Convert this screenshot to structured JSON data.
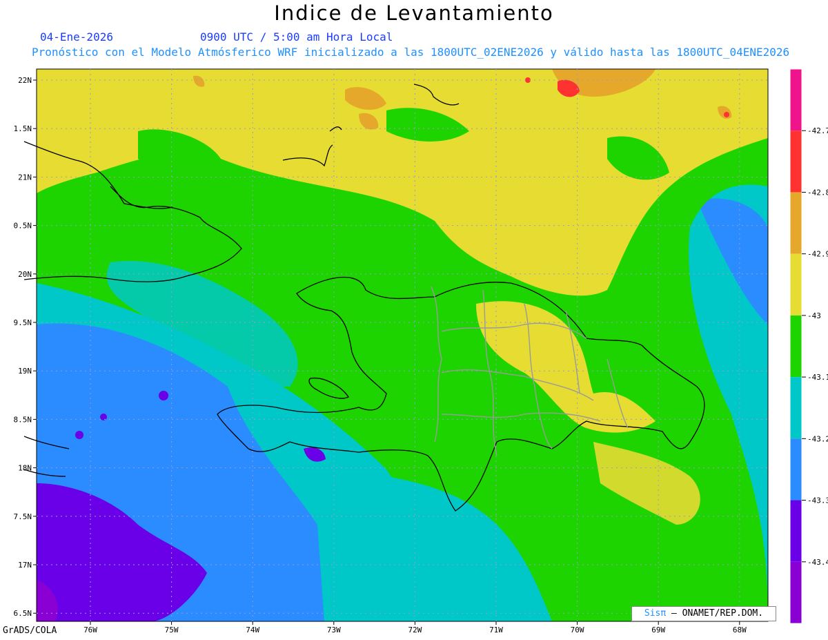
{
  "header": {
    "title": "Indice de Levantamiento",
    "date": "04-Ene-2026",
    "time": "0900 UTC / 5:00 am Hora Local",
    "subtitle": "Pronóstico con el Modelo Atmósferico WRF inicializado a las 1800UTC_02ENE2026 y válido hasta las  1800UTC_04ENE2026"
  },
  "map": {
    "lat_labels": [
      "22N",
      "1.5N",
      "21N",
      "0.5N",
      "20N",
      "9.5N",
      "19N",
      "8.5N",
      "18N",
      "7.5N",
      "17N",
      "6.5N"
    ],
    "lon_labels": [
      "76W",
      "75W",
      "74W",
      "73W",
      "72W",
      "71W",
      "70W",
      "69W",
      "68W"
    ],
    "field_colors": {
      "violet": "#8a00d4",
      "purple": "#6a00e8",
      "blue": "#2a8cff",
      "cyan": "#00c8c8",
      "green": "#1ed400",
      "yellow": "#e6dc32",
      "orange": "#e6a82a",
      "red": "#ff3232",
      "magenta": "#f0148c"
    }
  },
  "colorbar": {
    "labels": [
      "-42.7",
      "-42.8",
      "-42.9",
      "-43",
      "-43.1",
      "-43.2",
      "-43.3",
      "-43.4"
    ],
    "colors": [
      "#f0148c",
      "#ff3232",
      "#e6a82a",
      "#e6dc32",
      "#1ed400",
      "#00c8c8",
      "#2a8cff",
      "#6a00e8",
      "#8a00d4"
    ]
  },
  "footer": {
    "left": "GrADS/COLA",
    "credit_sis": "Sisπ",
    "credit_rest": "– ONAMET/REP.DOM."
  }
}
